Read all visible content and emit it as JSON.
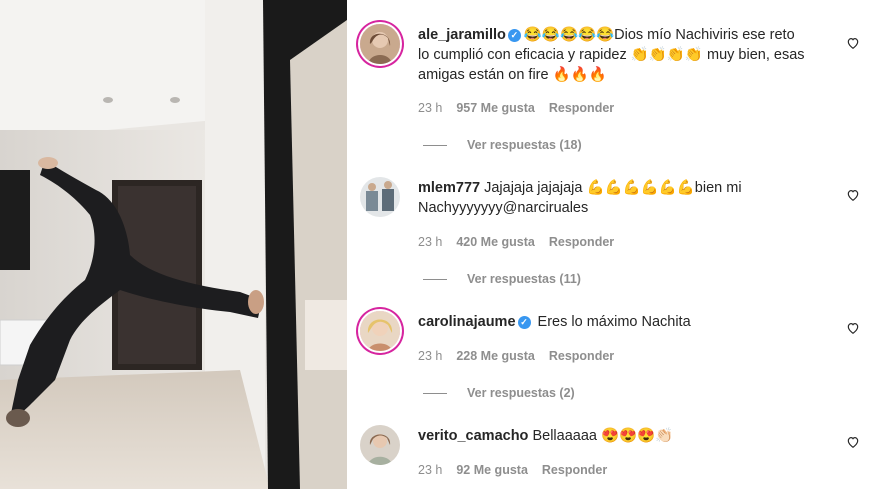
{
  "comments": [
    {
      "username": "ale_jaramillo",
      "verified": true,
      "text_line1": "😂😂😂😂😂Dios mío Nachiviris ese reto",
      "text_line2": "lo cumplió con eficacia y rapidez 👏👏👏👏 muy bien, esas",
      "text_line3": "amigas están on fire 🔥🔥🔥",
      "time": "23 h",
      "likes": "957 Me gusta",
      "reply": "Responder",
      "view_replies": "Ver respuestas (18)"
    },
    {
      "username": "mlem777",
      "verified": false,
      "text_line1": "Jajajaja jajajaja 💪💪💪💪💪💪bien mi",
      "text_line2": "Nachyyyyyyy@narciruales",
      "time": "23 h",
      "likes": "420 Me gusta",
      "reply": "Responder",
      "view_replies": "Ver respuestas (11)"
    },
    {
      "username": "carolinajaume",
      "verified": true,
      "text_line1": "Eres lo máximo Nachita",
      "time": "23 h",
      "likes": "228 Me gusta",
      "reply": "Responder",
      "view_replies": "Ver respuestas (2)"
    },
    {
      "username": "verito_camacho",
      "verified": false,
      "text_line1": "Bellaaaaa 😍😍😍👏🏻",
      "time": "23 h",
      "likes": "92 Me gusta",
      "reply": "Responder"
    }
  ],
  "icons": {
    "verified": "verified-badge-icon",
    "like": "heart-outline-icon"
  },
  "colors": {
    "text": "#262626",
    "secondary": "#8e8e8e",
    "verified": "#3897f0"
  }
}
